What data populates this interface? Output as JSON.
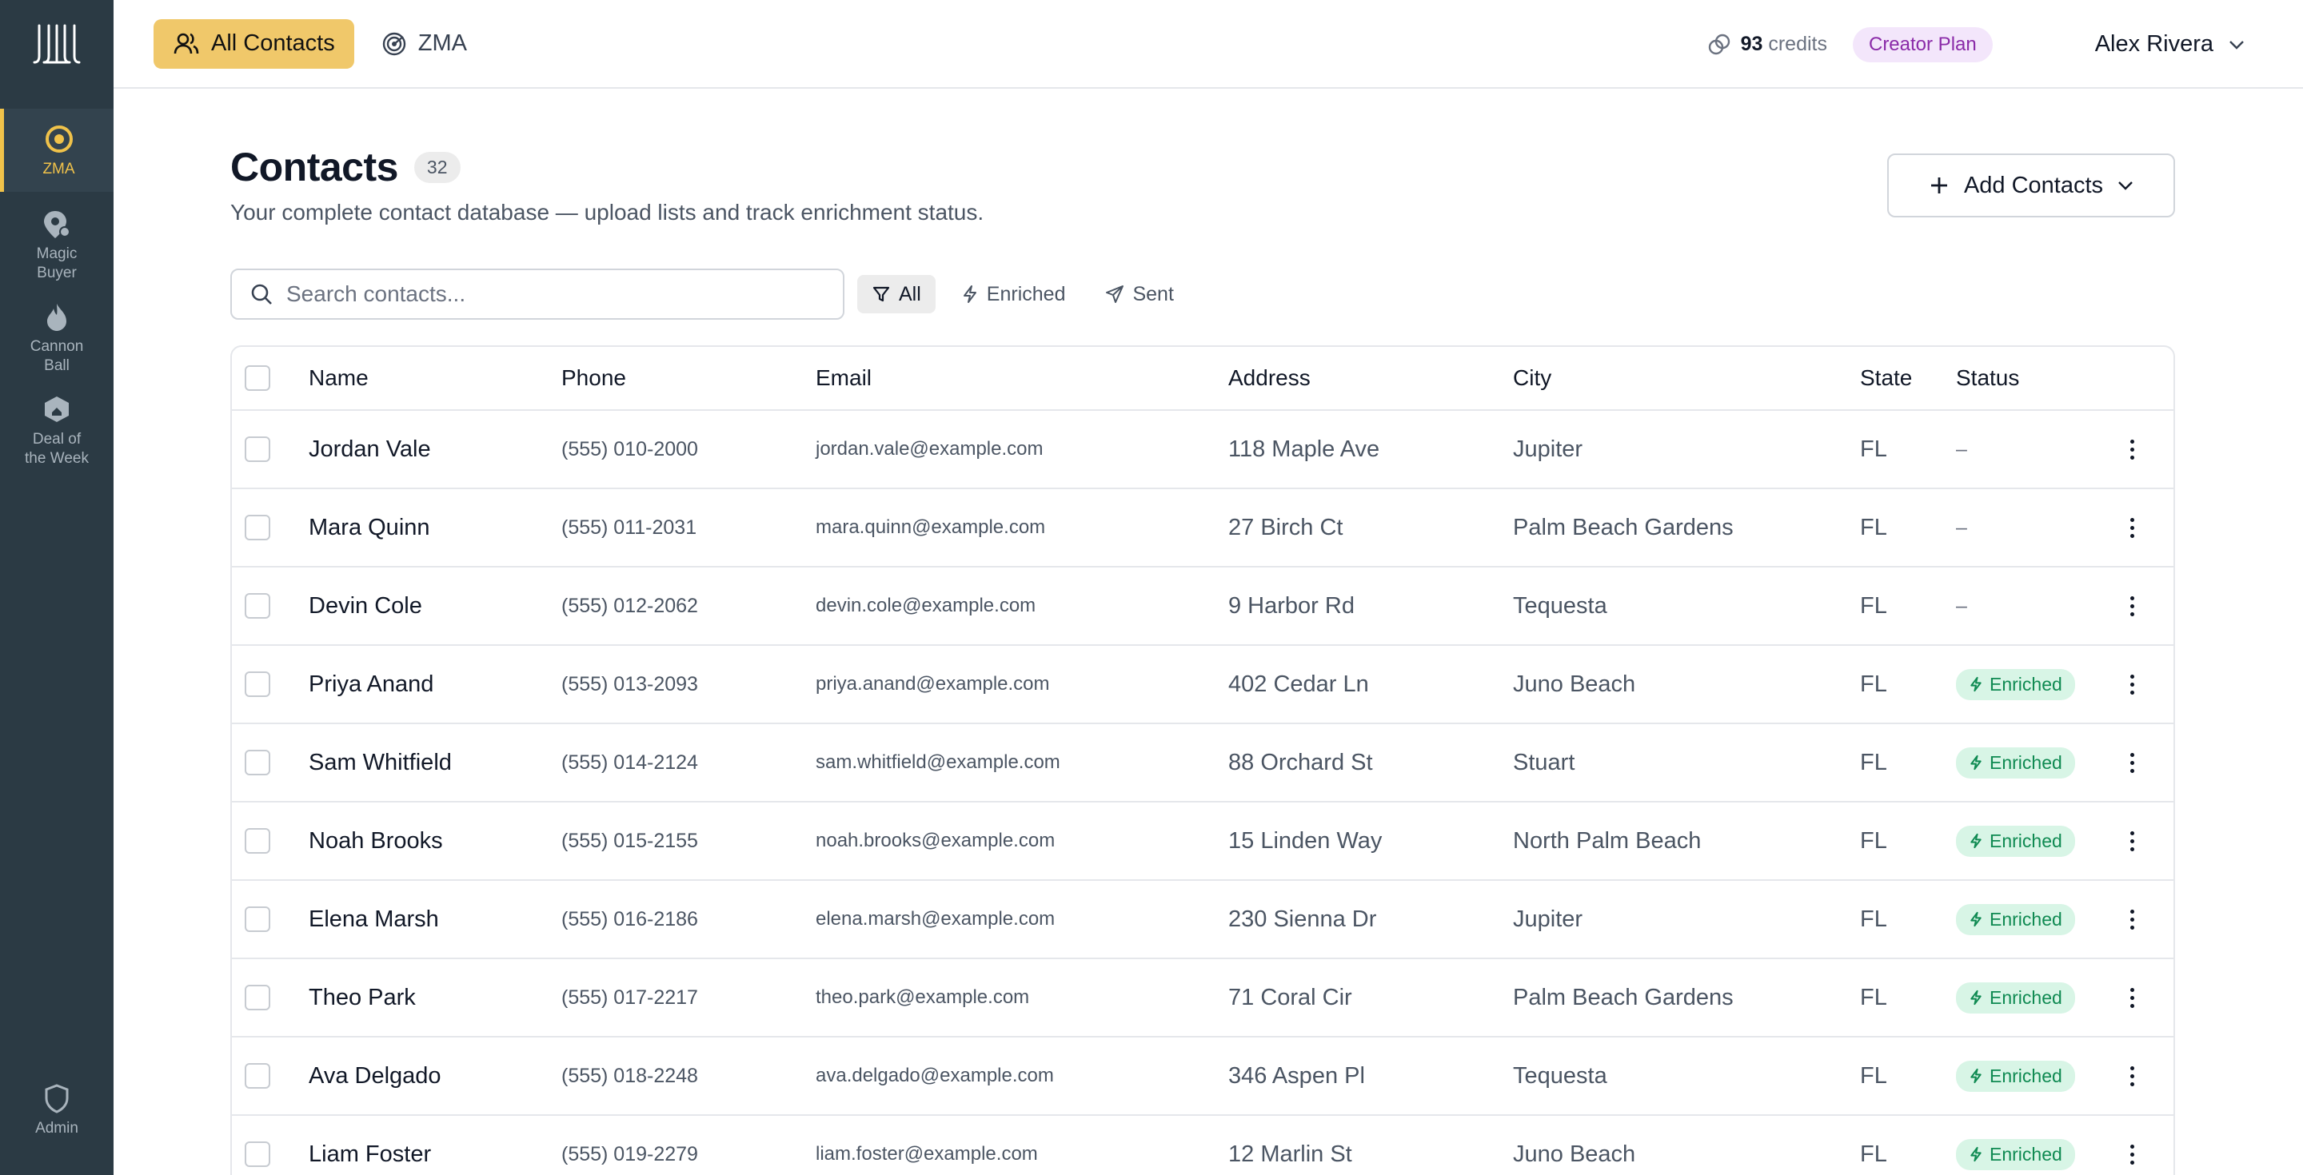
{
  "sidebar": {
    "items": [
      {
        "label": "ZMA",
        "icon": "target-icon",
        "active": true
      },
      {
        "label": "Magic\nBuyer",
        "icon": "location-pin-icon",
        "active": false
      },
      {
        "label": "Cannon\nBall",
        "icon": "flame-icon",
        "active": false
      },
      {
        "label": "Deal of\nthe Week",
        "icon": "home-badge-icon",
        "active": false
      }
    ],
    "admin_label": "Admin"
  },
  "topbar": {
    "tabs": [
      {
        "label": "All Contacts",
        "icon": "users-icon",
        "active": true
      },
      {
        "label": "ZMA",
        "icon": "radar-icon",
        "active": false
      }
    ],
    "credits_value": "93",
    "credits_label": "credits",
    "plan": "Creator Plan",
    "user_name": "Alex Rivera"
  },
  "header": {
    "title": "Contacts",
    "count": "32",
    "subtitle": "Your complete contact database — upload lists and track enrichment status.",
    "add_button": "Add Contacts"
  },
  "search": {
    "placeholder": "Search contacts..."
  },
  "filters": [
    {
      "label": "All",
      "icon": "filter-icon",
      "active": true
    },
    {
      "label": "Enriched",
      "icon": "bolt-icon",
      "active": false
    },
    {
      "label": "Sent",
      "icon": "send-icon",
      "active": false
    }
  ],
  "table": {
    "columns": [
      "Name",
      "Phone",
      "Email",
      "Address",
      "City",
      "State",
      "Status"
    ],
    "rows": [
      {
        "name": "Jordan Vale",
        "phone": "(555) 010-2000",
        "email": "jordan.vale@example.com",
        "address": "118 Maple Ave",
        "city": "Jupiter",
        "state": "FL",
        "status": "–"
      },
      {
        "name": "Mara Quinn",
        "phone": "(555) 011-2031",
        "email": "mara.quinn@example.com",
        "address": "27 Birch Ct",
        "city": "Palm Beach Gardens",
        "state": "FL",
        "status": "–"
      },
      {
        "name": "Devin Cole",
        "phone": "(555) 012-2062",
        "email": "devin.cole@example.com",
        "address": "9 Harbor Rd",
        "city": "Tequesta",
        "state": "FL",
        "status": "–"
      },
      {
        "name": "Priya Anand",
        "phone": "(555) 013-2093",
        "email": "priya.anand@example.com",
        "address": "402 Cedar Ln",
        "city": "Juno Beach",
        "state": "FL",
        "status": "Enriched"
      },
      {
        "name": "Sam Whitfield",
        "phone": "(555) 014-2124",
        "email": "sam.whitfield@example.com",
        "address": "88 Orchard St",
        "city": "Stuart",
        "state": "FL",
        "status": "Enriched"
      },
      {
        "name": "Noah Brooks",
        "phone": "(555) 015-2155",
        "email": "noah.brooks@example.com",
        "address": "15 Linden Way",
        "city": "North Palm Beach",
        "state": "FL",
        "status": "Enriched"
      },
      {
        "name": "Elena Marsh",
        "phone": "(555) 016-2186",
        "email": "elena.marsh@example.com",
        "address": "230 Sienna Dr",
        "city": "Jupiter",
        "state": "FL",
        "status": "Enriched"
      },
      {
        "name": "Theo Park",
        "phone": "(555) 017-2217",
        "email": "theo.park@example.com",
        "address": "71 Coral Cir",
        "city": "Palm Beach Gardens",
        "state": "FL",
        "status": "Enriched"
      },
      {
        "name": "Ava Delgado",
        "phone": "(555) 018-2248",
        "email": "ava.delgado@example.com",
        "address": "346 Aspen Pl",
        "city": "Tequesta",
        "state": "FL",
        "status": "Enriched"
      },
      {
        "name": "Liam Foster",
        "phone": "(555) 019-2279",
        "email": "liam.foster@example.com",
        "address": "12 Marlin St",
        "city": "Juno Beach",
        "state": "FL",
        "status": "Enriched"
      }
    ]
  },
  "colors": {
    "sidebar_bg": "#2b3a44",
    "accent": "#f0c24a",
    "tab_active": "#f0c86a",
    "enriched_bg": "#d8f5e6",
    "enriched_text": "#0f8a52",
    "plan_bg": "#f3e6fb",
    "plan_text": "#8a2aa8"
  }
}
